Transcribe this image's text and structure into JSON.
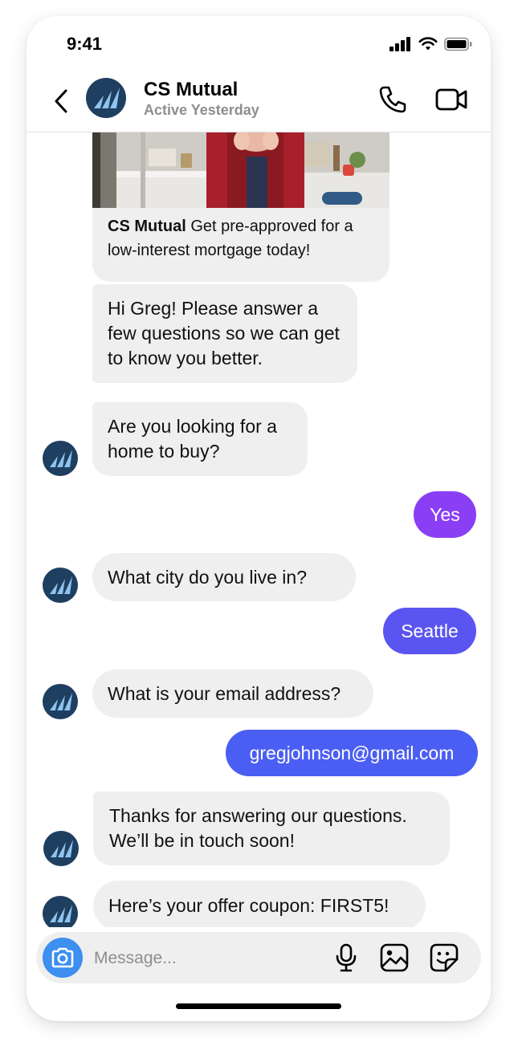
{
  "status_bar": {
    "time": "9:41"
  },
  "header": {
    "name": "CS Mutual",
    "status": "Active Yesterday",
    "icons": {
      "back": "chevron-left-icon",
      "call": "phone-icon",
      "video": "video-camera-icon"
    }
  },
  "chat": {
    "promo": {
      "sender": "CS Mutual",
      "text": " Get pre-approved for a low-interest mortgage today!"
    },
    "messages": [
      {
        "from": "business",
        "text": "Hi Greg! Please answer a few questions so we can get to know you better."
      },
      {
        "from": "business",
        "text": "Are you looking for a home to buy?"
      },
      {
        "from": "user",
        "text": "Yes"
      },
      {
        "from": "business",
        "text": "What city do you live in?"
      },
      {
        "from": "user",
        "text": "Seattle"
      },
      {
        "from": "business",
        "text": "What is your email address?"
      },
      {
        "from": "user",
        "text": "gregjohnson@gmail.com"
      },
      {
        "from": "business",
        "text": "Thanks for answering our questions. We’ll be in touch soon!"
      },
      {
        "from": "business",
        "text": "Here’s your offer coupon: FIRST5!"
      }
    ]
  },
  "composer": {
    "placeholder": "Message...",
    "icons": {
      "camera": "camera-icon",
      "mic": "microphone-icon",
      "gallery": "image-icon",
      "sticker": "sticker-icon"
    }
  },
  "colors": {
    "bubble_in": "#efefef",
    "bubble_out_purple": "#8a3ff5",
    "bubble_out_indigo": "#5a55f0",
    "bubble_out_blue": "#4b5ef3",
    "brand_navy": "#1f3f61",
    "brand_light": "#8ec4ee",
    "camera_button": "#3d8ff0"
  }
}
